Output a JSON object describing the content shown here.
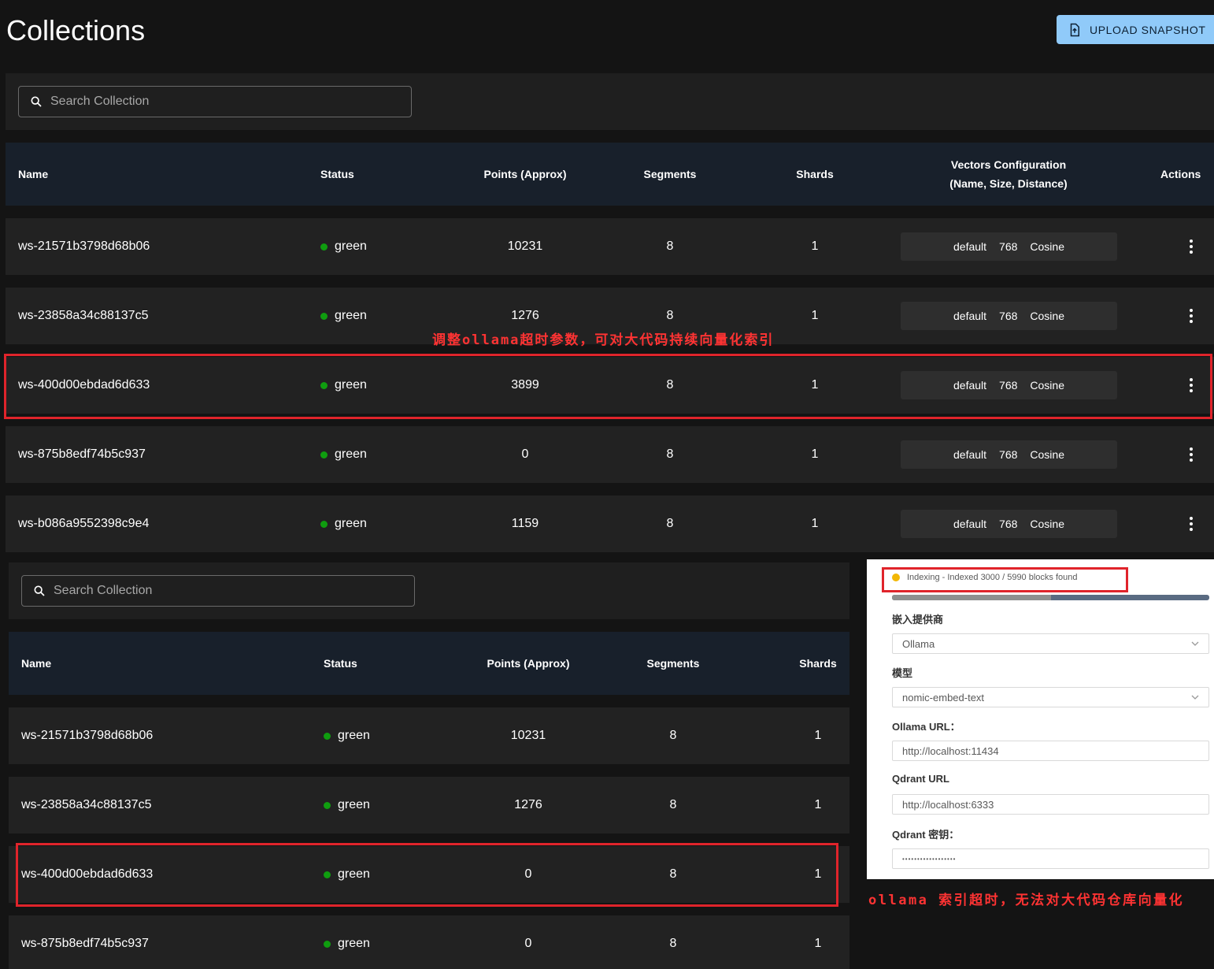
{
  "header": {
    "title": "Collections",
    "upload_label": "UPLOAD SNAPSHOT"
  },
  "search": {
    "placeholder": "Search Collection"
  },
  "table": {
    "columns": {
      "name": "Name",
      "status": "Status",
      "points": "Points (Approx)",
      "segments": "Segments",
      "shards": "Shards",
      "vectors_line1": "Vectors Configuration",
      "vectors_line2": "(Name, Size, Distance)",
      "actions": "Actions"
    },
    "rows": [
      {
        "name": "ws-21571b3798d68b06",
        "status": "green",
        "points": "10231",
        "segments": "8",
        "shards": "1",
        "vec_name": "default",
        "vec_size": "768",
        "vec_distance": "Cosine"
      },
      {
        "name": "ws-23858a34c88137c5",
        "status": "green",
        "points": "1276",
        "segments": "8",
        "shards": "1",
        "vec_name": "default",
        "vec_size": "768",
        "vec_distance": "Cosine"
      },
      {
        "name": "ws-400d00ebdad6d633",
        "status": "green",
        "points": "3899",
        "segments": "8",
        "shards": "1",
        "vec_name": "default",
        "vec_size": "768",
        "vec_distance": "Cosine"
      },
      {
        "name": "ws-875b8edf74b5c937",
        "status": "green",
        "points": "0",
        "segments": "8",
        "shards": "1",
        "vec_name": "default",
        "vec_size": "768",
        "vec_distance": "Cosine"
      },
      {
        "name": "ws-b086a9552398c9e4",
        "status": "green",
        "points": "1159",
        "segments": "8",
        "shards": "1",
        "vec_name": "default",
        "vec_size": "768",
        "vec_distance": "Cosine"
      }
    ]
  },
  "table2": {
    "rows": [
      {
        "name": "ws-21571b3798d68b06",
        "status": "green",
        "points": "10231",
        "segments": "8",
        "shards": "1"
      },
      {
        "name": "ws-23858a34c88137c5",
        "status": "green",
        "points": "1276",
        "segments": "8",
        "shards": "1"
      },
      {
        "name": "ws-400d00ebdad6d633",
        "status": "green",
        "points": "0",
        "segments": "8",
        "shards": "1"
      },
      {
        "name": "ws-875b8edf74b5c937",
        "status": "green",
        "points": "0",
        "segments": "8",
        "shards": "1"
      }
    ]
  },
  "annotations": {
    "top": "调整ollama超时参数，可对大代码持续向量化索引",
    "bottom": "ollama 索引超时，无法对大代码仓库向量化"
  },
  "settings": {
    "status_text": "Indexing - Indexed 3000 / 5990 blocks found",
    "progress_fraction": 0.5,
    "provider_label": "嵌入提供商",
    "provider_value": "Ollama",
    "model_label": "模型",
    "model_value": "nomic-embed-text",
    "ollama_url_label": "Ollama URL：",
    "ollama_url_value": "http://localhost:11434",
    "qdrant_url_label": "Qdrant URL",
    "qdrant_url_value": "http://localhost:6333",
    "qdrant_key_label": "Qdrant 密钥：",
    "qdrant_key_value": "••••••••••••••••••"
  },
  "colors": {
    "status_green": "#0f9d0f",
    "accent_blue": "#90caf9",
    "highlight_red": "#e0242b",
    "indexing_yellow": "#f2b705"
  }
}
